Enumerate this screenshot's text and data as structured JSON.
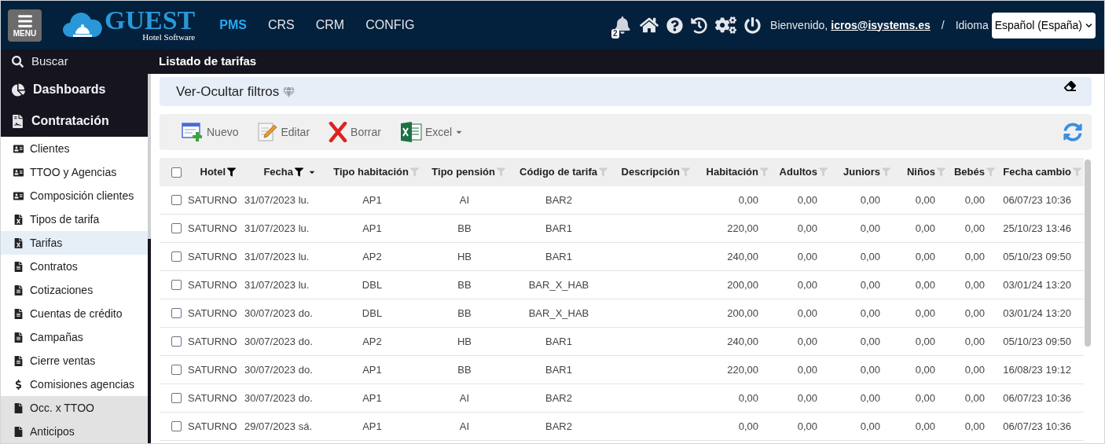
{
  "header": {
    "menu_label": "MENU",
    "logo_title": "GUEST",
    "logo_subtitle": "Hotel Software",
    "nav": [
      {
        "label": "PMS",
        "selected": true
      },
      {
        "label": "CRS",
        "selected": false
      },
      {
        "label": "CRM",
        "selected": false
      },
      {
        "label": "CONFIG",
        "selected": false
      }
    ],
    "notification_count": "2",
    "welcome": "Bienvenido,",
    "user": "icros@isystems.es",
    "separator": "/",
    "language_label": "Idioma",
    "language": "Español (España)"
  },
  "search_label": "Buscar",
  "page_title": "Listado de tarifas",
  "sidebar": {
    "sections": [
      {
        "label": "Dashboards",
        "kind": "chart"
      },
      {
        "label": "Contratación",
        "kind": "contract"
      }
    ],
    "items": [
      {
        "label": "Clientes",
        "kind": "contact",
        "selected": false
      },
      {
        "label": "TTOO y Agencias",
        "kind": "contact",
        "selected": false
      },
      {
        "label": "Composición clientes",
        "kind": "contact",
        "selected": false
      },
      {
        "label": "Tipos de tarifa",
        "kind": "excel",
        "selected": false
      },
      {
        "label": "Tarifas",
        "kind": "excel",
        "selected": true
      },
      {
        "label": "Contratos",
        "kind": "doc",
        "selected": false
      },
      {
        "label": "Cotizaciones",
        "kind": "doc",
        "selected": false
      },
      {
        "label": "Cuentas de crédito",
        "kind": "doc",
        "selected": false
      },
      {
        "label": "Campañas",
        "kind": "doc",
        "selected": false
      },
      {
        "label": "Cierre ventas",
        "kind": "doc",
        "selected": false
      },
      {
        "label": "Comisiones agencias",
        "kind": "dollar",
        "selected": false
      },
      {
        "label": "Occ. x TTOO",
        "kind": "file",
        "selected": false
      },
      {
        "label": "Anticipos",
        "kind": "file",
        "selected": false
      }
    ]
  },
  "filters_label": "Ver-Ocultar filtros",
  "toolbar": [
    {
      "label": "Nuevo",
      "kind": "new"
    },
    {
      "label": "Editar",
      "kind": "edit"
    },
    {
      "label": "Borrar",
      "kind": "delete"
    },
    {
      "label": "Excel",
      "kind": "excel"
    }
  ],
  "table": {
    "select_all_checked": false,
    "columns": [
      {
        "label": "Hotel",
        "filtered": true
      },
      {
        "label": "Fecha",
        "filtered": true,
        "sorted": true
      },
      {
        "label": "Tipo habitación",
        "filtered": false
      },
      {
        "label": "Tipo pensión",
        "filtered": false
      },
      {
        "label": "Código de tarifa",
        "filtered": false
      },
      {
        "label": "Descripción",
        "filtered": false
      },
      {
        "label": "Habitación",
        "filtered": false
      },
      {
        "label": "Adultos",
        "filtered": false
      },
      {
        "label": "Juniors",
        "filtered": false
      },
      {
        "label": "Niños",
        "filtered": false
      },
      {
        "label": "Bebés",
        "filtered": false
      },
      {
        "label": "Fecha cambio",
        "filtered": false
      }
    ],
    "rows": [
      {
        "checked": false,
        "cells": [
          "SATURNO",
          "31/07/2023 lu.",
          "AP1",
          "AI",
          "BAR2",
          "",
          "0,00",
          "0,00",
          "0,00",
          "0,00",
          "0,00",
          "06/07/23 10:36"
        ]
      },
      {
        "checked": false,
        "cells": [
          "SATURNO",
          "31/07/2023 lu.",
          "AP1",
          "BB",
          "BAR1",
          "",
          "220,00",
          "0,00",
          "0,00",
          "0,00",
          "0,00",
          "25/10/23 13:46"
        ]
      },
      {
        "checked": false,
        "cells": [
          "SATURNO",
          "31/07/2023 lu.",
          "AP2",
          "HB",
          "BAR1",
          "",
          "240,00",
          "0,00",
          "0,00",
          "0,00",
          "0,00",
          "05/10/23 09:50"
        ]
      },
      {
        "checked": false,
        "cells": [
          "SATURNO",
          "31/07/2023 lu.",
          "DBL",
          "BB",
          "BAR_X_HAB",
          "",
          "200,00",
          "0,00",
          "0,00",
          "0,00",
          "0,00",
          "03/01/24 13:20"
        ]
      },
      {
        "checked": false,
        "cells": [
          "SATURNO",
          "30/07/2023 do.",
          "DBL",
          "BB",
          "BAR_X_HAB",
          "",
          "200,00",
          "0,00",
          "0,00",
          "0,00",
          "0,00",
          "03/01/24 13:20"
        ]
      },
      {
        "checked": false,
        "cells": [
          "SATURNO",
          "30/07/2023 do.",
          "AP2",
          "HB",
          "BAR1",
          "",
          "240,00",
          "0,00",
          "0,00",
          "0,00",
          "0,00",
          "05/10/23 09:50"
        ]
      },
      {
        "checked": false,
        "cells": [
          "SATURNO",
          "30/07/2023 do.",
          "AP1",
          "BB",
          "BAR1",
          "",
          "220,00",
          "0,00",
          "0,00",
          "0,00",
          "0,00",
          "16/08/23 19:12"
        ]
      },
      {
        "checked": false,
        "cells": [
          "SATURNO",
          "30/07/2023 do.",
          "AP1",
          "AI",
          "BAR2",
          "",
          "0,00",
          "0,00",
          "0,00",
          "0,00",
          "0,00",
          "06/07/23 10:36"
        ]
      },
      {
        "checked": false,
        "cells": [
          "SATURNO",
          "29/07/2023 sá.",
          "AP1",
          "AI",
          "BAR2",
          "",
          "0,00",
          "0,00",
          "0,00",
          "0,00",
          "0,00",
          "06/07/23 10:36"
        ]
      }
    ]
  }
}
